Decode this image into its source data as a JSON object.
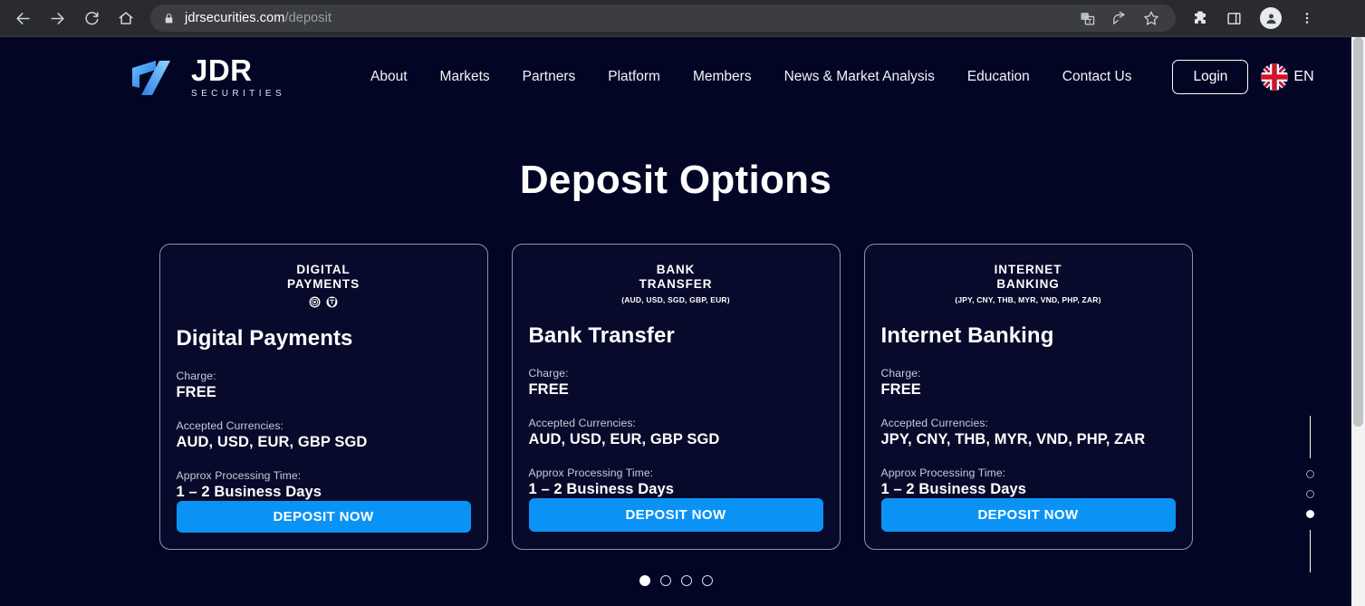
{
  "browser": {
    "back_icon": "back-arrow-icon",
    "forward_icon": "forward-arrow-icon",
    "reload_icon": "reload-icon",
    "home_icon": "home-icon",
    "lock_icon": "lock-icon",
    "url_domain": "jdrsecurities.com",
    "url_path": "/deposit",
    "translate_icon": "translate-icon",
    "share_icon": "share-icon",
    "bookmark_icon": "star-icon",
    "extensions_icon": "puzzle-piece-icon",
    "sidepanel_icon": "side-panel-icon",
    "profile_icon": "profile-avatar-icon",
    "menu_icon": "three-dot-menu-icon"
  },
  "site": {
    "logo": {
      "title": "JDR",
      "subtitle": "SECURITIES"
    },
    "nav": [
      {
        "label": "About"
      },
      {
        "label": "Markets"
      },
      {
        "label": "Partners"
      },
      {
        "label": "Platform"
      },
      {
        "label": "Members"
      },
      {
        "label": "News & Market Analysis"
      },
      {
        "label": "Education"
      },
      {
        "label": "Contact Us"
      }
    ],
    "login_label": "Login",
    "language": {
      "label": "EN",
      "flag_icon": "uk-flag-icon"
    }
  },
  "hero": {
    "title": "Deposit Options"
  },
  "labels": {
    "charge": "Charge:",
    "currencies": "Accepted Currencies:",
    "processing": "Approx Processing Time:",
    "deposit_button": "DEPOSIT NOW"
  },
  "cards": [
    {
      "kicker": "DIGITAL",
      "kicker2": "PAYMENTS",
      "kicker_sub": "",
      "coins": [
        "coin-badge-icon",
        "tether-badge-icon"
      ],
      "title": "Digital Payments",
      "charge": "FREE",
      "currencies": "AUD, USD, EUR, GBP SGD",
      "processing": "1 – 2 Business Days",
      "button": "DEPOSIT NOW"
    },
    {
      "kicker": "BANK",
      "kicker2": "TRANSFER",
      "kicker_sub": "(AUD, USD, SGD, GBP, EUR)",
      "coins": [],
      "title": "Bank Transfer",
      "charge": "FREE",
      "currencies": "AUD, USD, EUR, GBP SGD",
      "processing": "1 – 2 Business Days",
      "button": "DEPOSIT NOW"
    },
    {
      "kicker": "INTERNET",
      "kicker2": "BANKING",
      "kicker_sub": "(JPY, CNY, THB, MYR, VND, PHP, ZAR)",
      "coins": [],
      "title": "Internet Banking",
      "charge": "FREE",
      "currencies": "JPY, CNY, THB, MYR, VND, PHP, ZAR",
      "processing": "1 – 2 Business Days",
      "button": "DEPOSIT NOW"
    }
  ],
  "carousel": {
    "total": 4,
    "active_index": 0
  },
  "side_indicator": {
    "total": 3,
    "active_index": 2
  },
  "colors": {
    "page_background": "#030524",
    "card_background": "#070a2b",
    "accent_blue": "#0a93f5",
    "card_border": "#8e93ad",
    "text_primary": "#ffffff",
    "text_muted": "#c9ccd8"
  }
}
